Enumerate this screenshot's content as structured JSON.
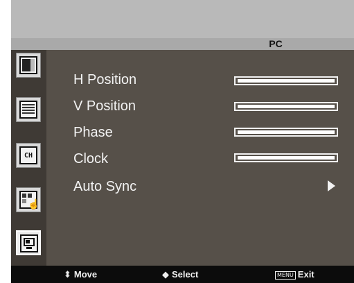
{
  "osd": {
    "title": "PC",
    "menu_items": [
      {
        "label": "H Position",
        "level": 0
      },
      {
        "label": "V Position",
        "level": 0
      },
      {
        "label": "Phase",
        "level": 0
      },
      {
        "label": "Clock",
        "level": 0
      },
      {
        "label": "Auto Sync"
      }
    ],
    "sidebar_icons": [
      "picture-icon",
      "audio-icon",
      "channel-icon",
      "function-icon",
      "pc-icon"
    ],
    "active_sidebar": "pc-icon",
    "channel_icon_text": "CH",
    "footer": {
      "move_glyph": "⬍",
      "move_label": "Move",
      "select_glyph": "◆",
      "select_label": "Select",
      "menu_key": "MENU",
      "exit_label": "Exit"
    },
    "colors": {
      "panel": "#565049",
      "sidebar": "#3f3a35",
      "title_bar": "#a9a9a9",
      "top_band": "#b9b9b9",
      "footer_bar": "#0c0c0c",
      "text": "#f2f2f2"
    }
  }
}
